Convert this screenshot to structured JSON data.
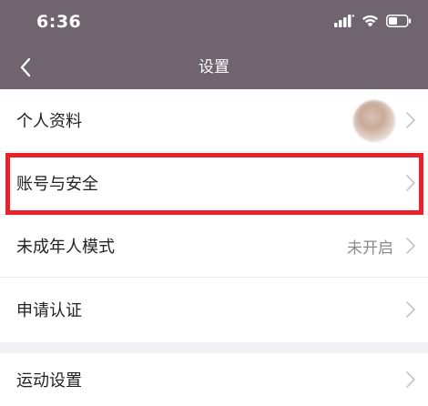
{
  "status_bar": {
    "time": "6:36",
    "icons": [
      "signal-icon",
      "wifi-icon",
      "battery-icon"
    ]
  },
  "nav": {
    "title": "设置",
    "back_icon": "chevron-left-icon"
  },
  "settings": {
    "items": [
      {
        "label": "个人资料",
        "value": ""
      },
      {
        "label": "账号与安全",
        "value": ""
      },
      {
        "label": "未成年人模式",
        "value": "未开启"
      },
      {
        "label": "申请认证",
        "value": ""
      }
    ],
    "items2": [
      {
        "label": "运动设置",
        "value": ""
      }
    ]
  },
  "colors": {
    "header_bg": "#706471",
    "highlight": "#e8212a",
    "page_bg": "#f2f2f4"
  }
}
